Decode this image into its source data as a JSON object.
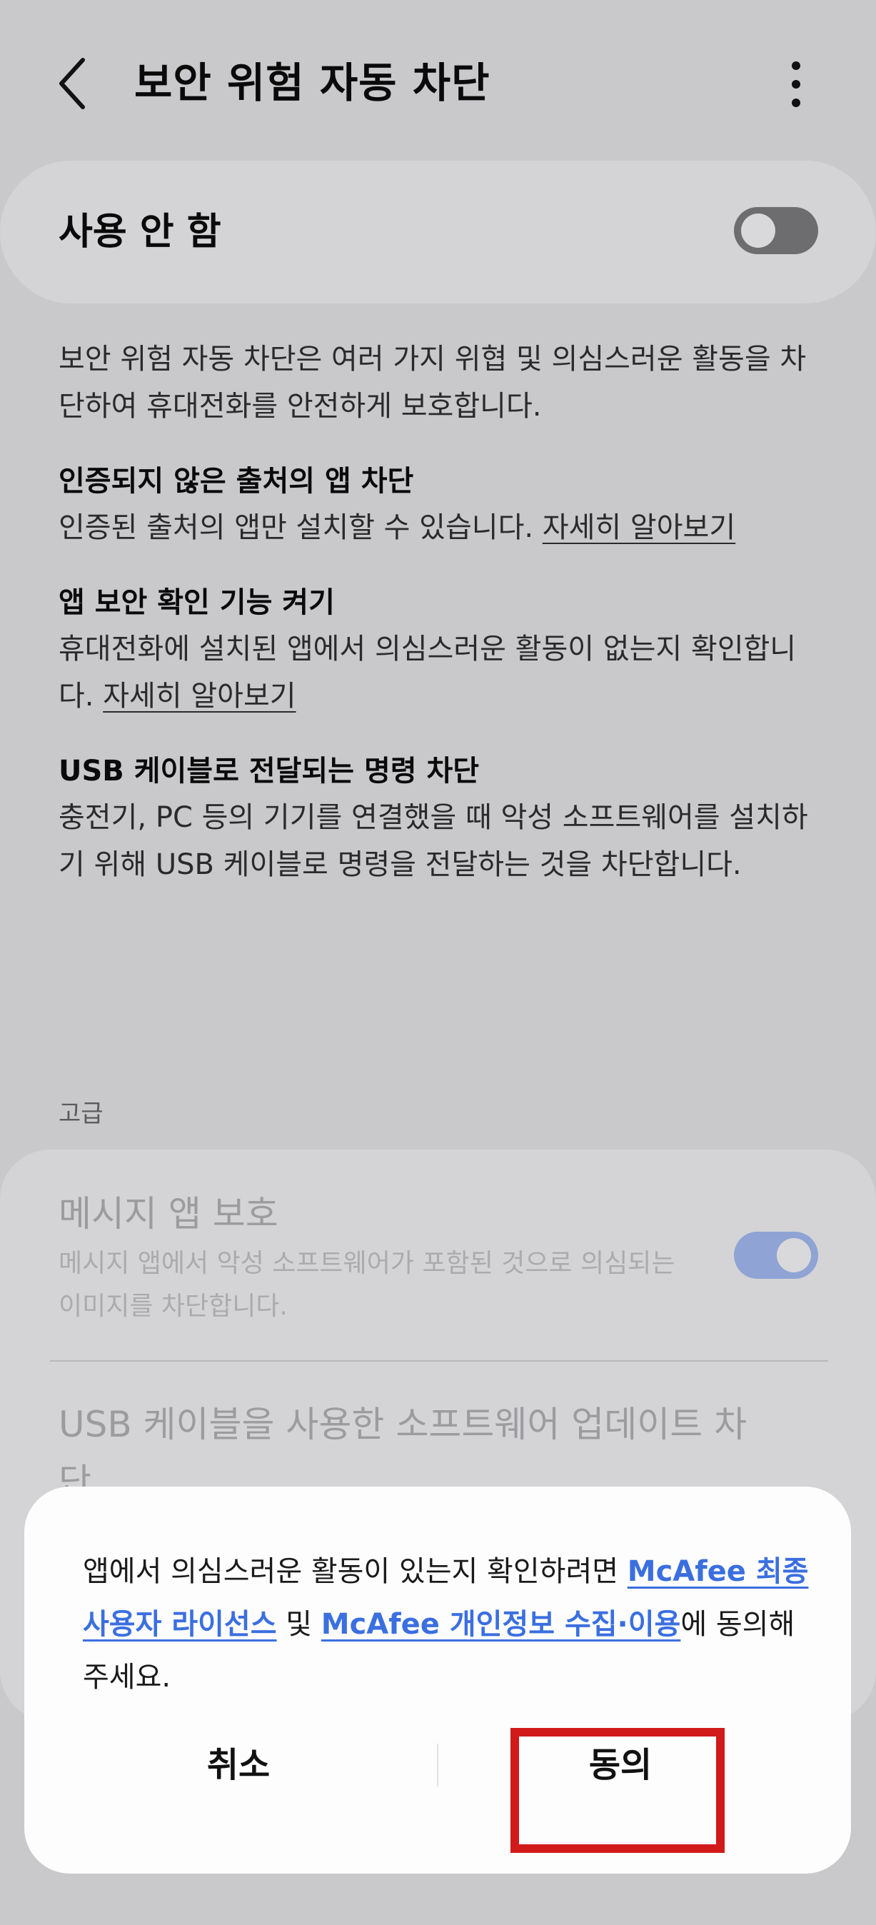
{
  "header": {
    "title": "보안 위험 자동 차단",
    "back_icon": "chevron-left-icon",
    "more_icon": "more-vertical-icon"
  },
  "master": {
    "label": "사용 안 함",
    "enabled": false
  },
  "description": "보안 위험 자동 차단은 여러 가지 위협 및 의심스러운 활동을 차단하여 휴대전화를 안전하게 보호합니다.",
  "features": [
    {
      "title": "인증되지 않은 출처의 앱 차단",
      "desc": "인증된 출처의 앱만 설치할 수 있습니다. ",
      "link": "자세히 알아보기"
    },
    {
      "title": "앱 보안 확인 기능 켜기",
      "desc": "휴대전화에 설치된 앱에서 의심스러운 활동이 없는지 확인합니다. ",
      "link": "자세히 알아보기"
    },
    {
      "title": "USB 케이블로 전달되는 명령 차단",
      "desc": "충전기, PC 등의 기기를 연결했을 때 악성 소프트웨어를 설치하기 위해 USB 케이블로 명령을 전달하는 것을 차단합니다.",
      "link": ""
    }
  ],
  "advanced": {
    "section_label": "고급",
    "items": [
      {
        "title": "메시지 앱 보호",
        "desc": "메시지 앱에서 악성 소프트웨어가 포함된 것으로 의심되는 이미지를 차단합니다.",
        "enabled": true
      },
      {
        "title": "USB 케이블을 사용한 소프트웨어 업데이트 차단"
      }
    ]
  },
  "dialog": {
    "text_before": "앱에서 의심스러운 활동이 있는지 확인하려면 ",
    "link1": "McAfee 최종 사용자 라이선스",
    "text_mid": " 및 ",
    "link2": "McAfee 개인정보 수집·이용",
    "text_after": "에 동의해 주세요.",
    "cancel_label": "취소",
    "agree_label": "동의"
  },
  "colors": {
    "dim_background": "#c9c9cc",
    "card": "#d4d4d7",
    "dialog": "#fdfdfd",
    "link": "#3b6fe0",
    "toggle_on": "#8fa3d4",
    "highlight": "#d11a1a"
  }
}
